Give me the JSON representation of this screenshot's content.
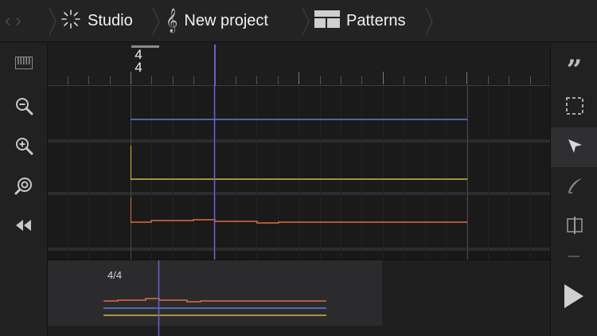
{
  "topbar": {
    "breadcrumbs": [
      {
        "label": "Studio",
        "icon": "studio-icon"
      },
      {
        "label": "New project",
        "icon": "treble-clef-icon"
      },
      {
        "label": "Patterns",
        "icon": "patterns-grid-icon"
      }
    ]
  },
  "timeline": {
    "time_signature": {
      "numerator": "4",
      "denominator": "4"
    }
  },
  "overview": {
    "time_signature_label": "4/4"
  },
  "left_tools": [
    "keyboard-icon",
    "zoom-out-icon",
    "zoom-in-icon",
    "zoom-fit-icon",
    "rewind-icon"
  ],
  "right_tools": [
    "quote-icon",
    "select-box-icon",
    "pointer-icon",
    "pen-icon",
    "split-icon"
  ],
  "colors": {
    "track_blue": "#6a78d8",
    "track_yellow": "#d9b73a",
    "track_orange": "#e06c3e",
    "playhead": "#6f5fc9"
  }
}
